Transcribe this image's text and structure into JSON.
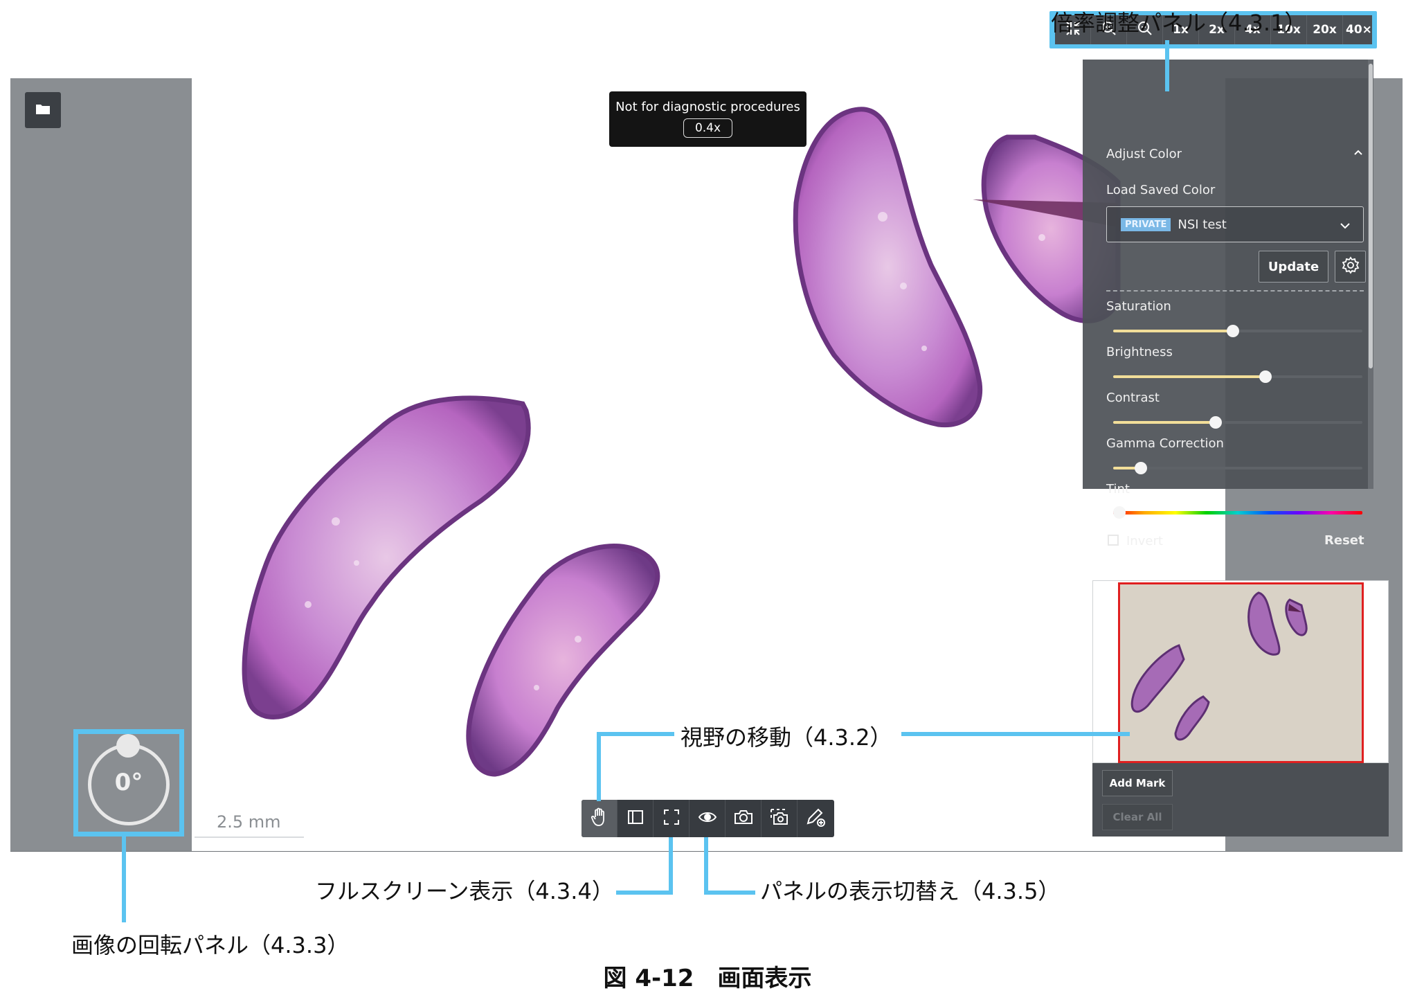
{
  "callouts": {
    "zoom_panel": "倍率調整パネル（4.3.1）",
    "move_view": "視野の移動（4.3.2）",
    "rotation_panel": "画像の回転パネル（4.3.3）",
    "fullscreen": "フルスクリーン表示（4.3.4）",
    "panel_toggle": "パネルの表示切替え（4.3.5）"
  },
  "caption": "図 4-12　画面表示",
  "viewer": {
    "notice": "Not for diagnostic procedures",
    "current_zoom": "0.4x",
    "scale_bar": "2.5 mm",
    "rotation": "0°"
  },
  "zoom_toolbar": {
    "presets": [
      "1x",
      "2x",
      "4x",
      "10x",
      "20x",
      "40×"
    ]
  },
  "color_panel": {
    "title": "Adjust Color",
    "load_label": "Load Saved Color",
    "badge": "PRIVATE",
    "selected_color": "NSI test",
    "update_label": "Update",
    "sliders": [
      {
        "label": "Saturation",
        "value": 0.48
      },
      {
        "label": "Brightness",
        "value": 0.61
      },
      {
        "label": "Contrast",
        "value": 0.41
      },
      {
        "label": "Gamma Correction",
        "value": 0.11
      }
    ],
    "tint_label": "Tint",
    "tint_value": 0.0,
    "invert_label": "Invert",
    "reset_label": "Reset"
  },
  "minimap": {
    "add_mark": "Add Mark",
    "clear_all": "Clear All"
  },
  "colors": {
    "accent": "#5bc3f0",
    "viewer_gray": "#8a8e92",
    "panel_bg": "#4e5257",
    "slider_fill": "#f2de99",
    "minimap_frame": "#e02020",
    "tissue_pink": "#d98ccf",
    "tissue_purple": "#7b4a9a"
  }
}
